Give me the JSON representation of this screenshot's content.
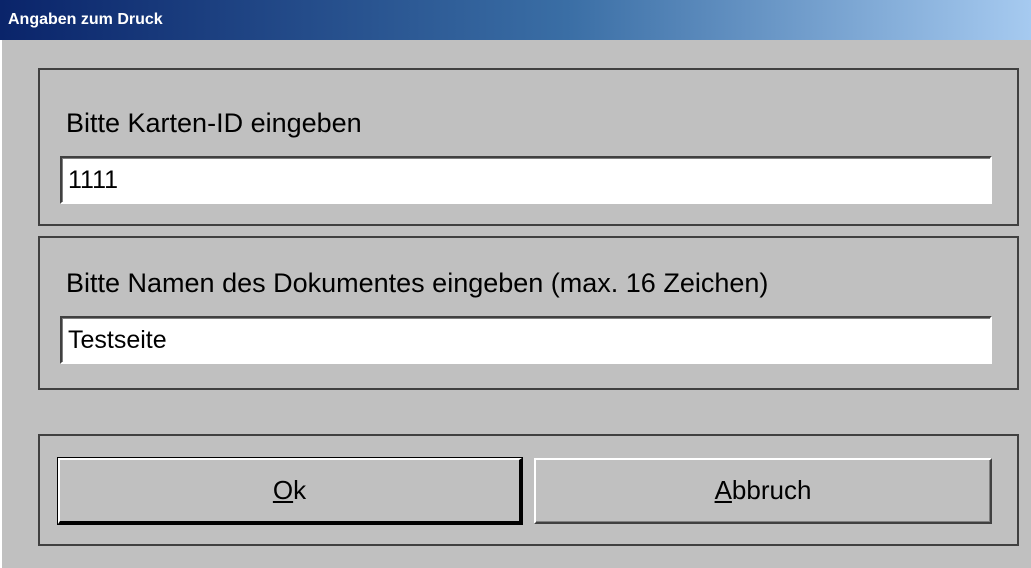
{
  "window": {
    "title": "Angaben zum Druck"
  },
  "card_group": {
    "label": "Bitte Karten-ID eingeben",
    "value": "1111"
  },
  "document_group": {
    "label": "Bitte Namen des Dokumentes eingeben (max. 16 Zeichen)",
    "value": "Testseite"
  },
  "buttons": {
    "ok": {
      "mnemonic": "O",
      "rest": "k"
    },
    "cancel": {
      "mnemonic": "A",
      "rest": "bbruch"
    }
  },
  "colors": {
    "titlebar_start": "#0a246a",
    "titlebar_end": "#a6caf0",
    "face": "#c0c0c0"
  }
}
